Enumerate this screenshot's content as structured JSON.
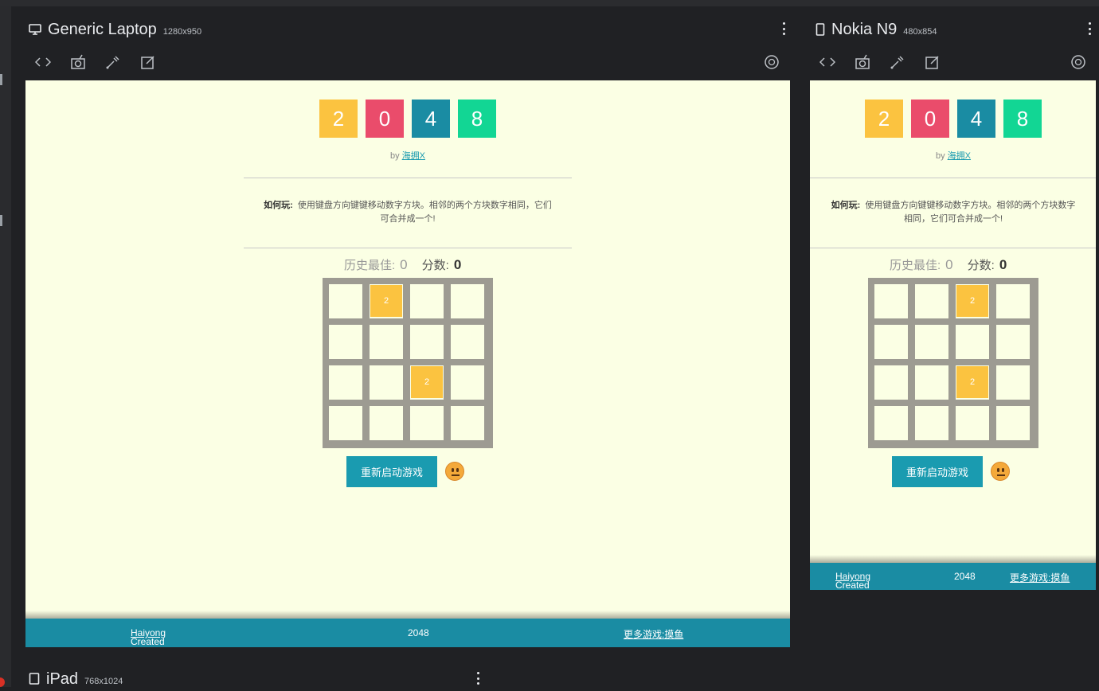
{
  "devices": {
    "laptop": {
      "name": "Generic Laptop",
      "res": "1280x950",
      "type_icon": "desktop-icon"
    },
    "nokia": {
      "name": "Nokia N9",
      "res": "480x854",
      "type_icon": "phone-icon"
    },
    "ipad": {
      "name": "iPad",
      "res": "768x1024",
      "type_icon": "tablet-icon"
    }
  },
  "toolbar_icons": [
    "code-icon",
    "screenshot-icon",
    "eyedropper-icon",
    "edit-icon",
    "rotate-icon"
  ],
  "game": {
    "logo_digits": [
      "2",
      "0",
      "4",
      "8"
    ],
    "logo_colors": [
      "#fbc340",
      "#ea4c6b",
      "#1a8ca3",
      "#12d694"
    ],
    "by_prefix": "by",
    "by_author": "海拥X",
    "howto_label": "如何玩:",
    "howto_text": "使用键盘方向键键移动数字方块。相邻的两个方块数字相同，它们可合并成一个!",
    "best_label": "历史最佳:",
    "best_value": "0",
    "score_label": "分数:",
    "score_value": "0",
    "restart_label": "重新启动游戏",
    "laptop_tiles": [
      {
        "row": 0,
        "col": 1,
        "value": "2"
      },
      {
        "row": 2,
        "col": 2,
        "value": "2"
      }
    ],
    "nokia_tiles": [
      {
        "row": 0,
        "col": 2,
        "value": "2"
      },
      {
        "row": 2,
        "col": 2,
        "value": "2"
      }
    ]
  },
  "footer": {
    "created_prefix": "Created by",
    "created_author": "Haiyong",
    "center": "2048",
    "more_games": "更多游戏:摸鱼"
  },
  "colors": {
    "screen_bg": "#fbffe4",
    "footer_bg": "#1a8ca3",
    "tile": "#fbc340",
    "restart": "#1a9bb0"
  }
}
